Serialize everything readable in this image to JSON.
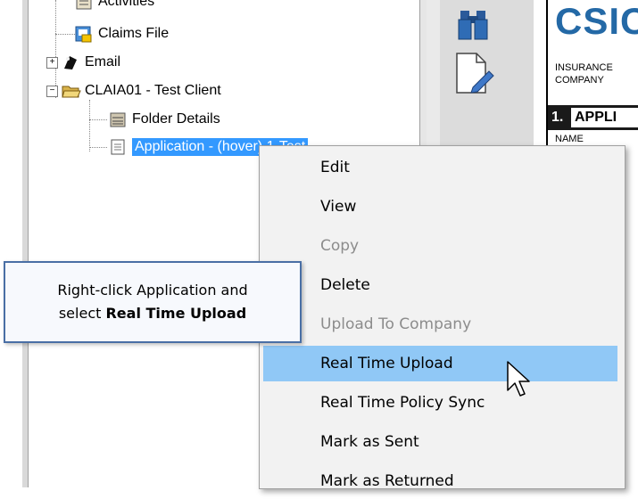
{
  "tree": {
    "items": [
      {
        "label": "Activities"
      },
      {
        "label": "Claims File"
      },
      {
        "label": "Email"
      },
      {
        "label": "CLAIA01 - Test Client"
      },
      {
        "label": "Folder Details"
      },
      {
        "label": "Application - (hover) 1-Test"
      }
    ]
  },
  "document": {
    "logo": "CSIC",
    "insurance_line1": "INSURANCE",
    "insurance_line2": "COMPANY",
    "section_number": "1.",
    "section_label": "APPLI",
    "name_label": "NAME"
  },
  "context_menu": {
    "items": [
      {
        "label": "Edit",
        "state": "enabled"
      },
      {
        "label": "View",
        "state": "enabled"
      },
      {
        "label": "Copy",
        "state": "disabled"
      },
      {
        "label": "Delete",
        "state": "enabled"
      },
      {
        "label": "Upload To Company",
        "state": "disabled"
      },
      {
        "label": "Real Time Upload",
        "state": "highlighted"
      },
      {
        "label": "Real Time Policy Sync",
        "state": "enabled"
      },
      {
        "label": "Mark as  Sent",
        "state": "enabled"
      },
      {
        "label": "Mark as Returned",
        "state": "enabled"
      }
    ]
  },
  "callout": {
    "line1": "Right-click Application and",
    "line2_prefix": "select ",
    "line2_bold": "Real Time Upload"
  },
  "colors": {
    "highlight": "#90c8f6",
    "selection": "#3399ff",
    "callout_border": "#4a6fa5",
    "logo": "#2469a6"
  }
}
